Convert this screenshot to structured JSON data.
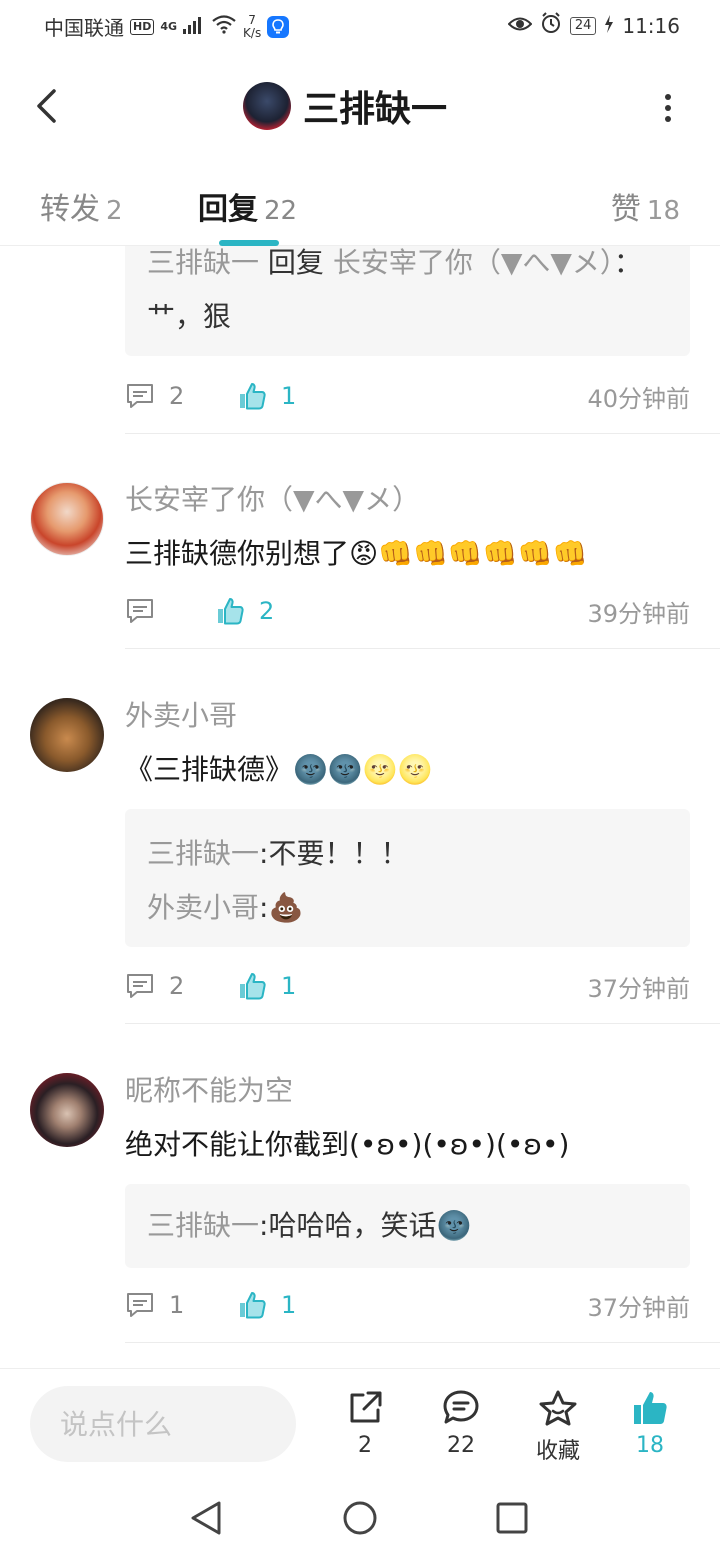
{
  "status_bar": {
    "carrier": "中国联通",
    "hd": "HD",
    "network": "4G",
    "speed_value": "7",
    "speed_unit": "K/s",
    "battery": "24",
    "time": "11:16"
  },
  "header": {
    "title": "三排缺一"
  },
  "tabs": [
    {
      "label": "转发",
      "count": "2"
    },
    {
      "label": "回复",
      "count": "22"
    },
    {
      "label": "赞",
      "count": "18"
    }
  ],
  "comments": [
    {
      "partial": true,
      "replies": [
        {
          "name": "三排缺一",
          "connector": " 回复 ",
          "target": "长安宰了你（▼へ▼メ）",
          "text": "：艹，狠"
        }
      ],
      "reply_count": "2",
      "like_count": "1",
      "time": "40分钟前"
    },
    {
      "name": "长安宰了你（▼へ▼メ）",
      "text": "三排缺德你别想了😡👊👊👊👊👊👊",
      "reply_count": "",
      "like_count": "2",
      "time": "39分钟前"
    },
    {
      "name": "外卖小哥",
      "text": "《三排缺德》🌚🌚🌝🌝",
      "replies": [
        {
          "name": "三排缺一",
          "text": ":不要！！！"
        },
        {
          "name": "外卖小哥",
          "text": ":💩"
        }
      ],
      "reply_count": "2",
      "like_count": "1",
      "time": "37分钟前"
    },
    {
      "name": "昵称不能为空",
      "text": "绝对不能让你截到(•ʚ•)(•ʚ•)(•ʚ•)",
      "replies": [
        {
          "name": "三排缺一",
          "text": ":哈哈哈，笑话🌚"
        }
      ],
      "reply_count": "1",
      "like_count": "1",
      "time": "37分钟前"
    }
  ],
  "bottom_bar": {
    "input_placeholder": "说点什么",
    "share_count": "2",
    "comment_count": "22",
    "favorite_label": "收藏",
    "like_count": "18"
  },
  "colors": {
    "accent": "#2bb5c4",
    "muted_text": "#999999",
    "quote_bg": "#f6f6f6"
  }
}
